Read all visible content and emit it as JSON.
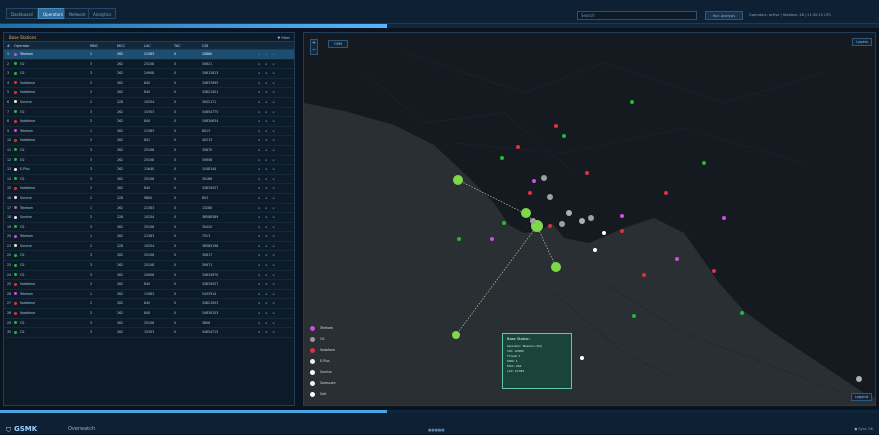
{
  "tabs": [
    "Dashboard",
    "Operators",
    "Network",
    "Analytics"
  ],
  "active_tab_index": 1,
  "search": {
    "placeholder": "Search"
  },
  "top_button": "Run Analysis",
  "status_text": "Operators: active | Stations: 48 | 21:30:15 UTC",
  "progress": 0.44,
  "left_panel": {
    "title": "Base Stations",
    "filter_label": "Filter",
    "columns": [
      "#",
      "Operator",
      "MNC",
      "MCC",
      "LAC",
      "TAC",
      "CID",
      ""
    ],
    "rows": [
      {
        "n": "1",
        "op": "Telekom",
        "mnc": "1",
        "mcc": "262",
        "lac": "21383",
        "tac": "0",
        "cid": "10880",
        "color": "#c850e0",
        "sel": true
      },
      {
        "n": "2",
        "op": "O2",
        "mnc": "3",
        "mcc": "262",
        "lac": "25108",
        "tac": "0",
        "cid": "30821",
        "color": "#22b838"
      },
      {
        "n": "3",
        "op": "O2",
        "mnc": "3",
        "mcc": "262",
        "lac": "24908",
        "tac": "0",
        "cid": "34612813",
        "color": "#22b838"
      },
      {
        "n": "4",
        "op": "Vodafone",
        "mnc": "2",
        "mcc": "262",
        "lac": "840",
        "tac": "0",
        "cid": "34837695",
        "color": "#e03040"
      },
      {
        "n": "5",
        "op": "Vodafone",
        "mnc": "2",
        "mcc": "262",
        "lac": "840",
        "tac": "0",
        "cid": "34821401",
        "color": "#e03040"
      },
      {
        "n": "6",
        "op": "Sunrise",
        "mnc": "2",
        "mcc": "228",
        "lac": "10254",
        "tac": "0",
        "cid": "3002171",
        "color": "#e8e8e8"
      },
      {
        "n": "7",
        "op": "O2",
        "mnc": "3",
        "mcc": "262",
        "lac": "15303",
        "tac": "0",
        "cid": "54654775",
        "color": "#22b838"
      },
      {
        "n": "8",
        "op": "Vodafone",
        "mnc": "2",
        "mcc": "262",
        "lac": "840",
        "tac": "0",
        "cid": "34820634",
        "color": "#e03040"
      },
      {
        "n": "9",
        "op": "Telekom",
        "mnc": "1",
        "mcc": "262",
        "lac": "21383",
        "tac": "0",
        "cid": "6013",
        "color": "#c850e0"
      },
      {
        "n": "10",
        "op": "Vodafone",
        "mnc": "2",
        "mcc": "262",
        "lac": "841",
        "tac": "0",
        "cid": "40213",
        "color": "#e03040"
      },
      {
        "n": "11",
        "op": "O2",
        "mnc": "3",
        "mcc": "262",
        "lac": "25108",
        "tac": "0",
        "cid": "30870",
        "color": "#22b838"
      },
      {
        "n": "12",
        "op": "O2",
        "mnc": "3",
        "mcc": "262",
        "lac": "25108",
        "tac": "0",
        "cid": "30658",
        "color": "#22b838"
      },
      {
        "n": "13",
        "op": "E-Plus",
        "mnc": "3",
        "mcc": "262",
        "lac": "11640",
        "tac": "0",
        "cid": "1048144",
        "color": "#f0f0f0"
      },
      {
        "n": "14",
        "op": "O2",
        "mnc": "3",
        "mcc": "262",
        "lac": "25108",
        "tac": "0",
        "cid": "30166",
        "color": "#22b838"
      },
      {
        "n": "15",
        "op": "Vodafone",
        "mnc": "2",
        "mcc": "262",
        "lac": "840",
        "tac": "0",
        "cid": "34834057",
        "color": "#e03040"
      },
      {
        "n": "16",
        "op": "Sunrise",
        "mnc": "2",
        "mcc": "228",
        "lac": "9800",
        "tac": "0",
        "cid": "803",
        "color": "#e8e8e8"
      },
      {
        "n": "17",
        "op": "Telekom",
        "mnc": "1",
        "mcc": "262",
        "lac": "21383",
        "tac": "0",
        "cid": "13280",
        "color": "#c850e0"
      },
      {
        "n": "18",
        "op": "Sunrise",
        "mnc": "2",
        "mcc": "228",
        "lac": "10254",
        "tac": "0",
        "cid": "38588389",
        "color": "#e8e8e8"
      },
      {
        "n": "19",
        "op": "O2",
        "mnc": "3",
        "mcc": "262",
        "lac": "25108",
        "tac": "0",
        "cid": "30420",
        "color": "#22b838"
      },
      {
        "n": "20",
        "op": "Telekom",
        "mnc": "1",
        "mcc": "262",
        "lac": "21383",
        "tac": "0",
        "cid": "7513",
        "color": "#c850e0"
      },
      {
        "n": "21",
        "op": "Sunrise",
        "mnc": "2",
        "mcc": "228",
        "lac": "10254",
        "tac": "0",
        "cid": "38585198",
        "color": "#e8e8e8"
      },
      {
        "n": "22",
        "op": "O2",
        "mnc": "3",
        "mcc": "262",
        "lac": "25108",
        "tac": "0",
        "cid": "30817",
        "color": "#22b838"
      },
      {
        "n": "23",
        "op": "O2",
        "mnc": "3",
        "mcc": "262",
        "lac": "25108",
        "tac": "0",
        "cid": "30671",
        "color": "#22b838"
      },
      {
        "n": "24",
        "op": "O2",
        "mnc": "3",
        "mcc": "262",
        "lac": "24908",
        "tac": "0",
        "cid": "34634970",
        "color": "#22b838"
      },
      {
        "n": "25",
        "op": "Vodafone",
        "mnc": "2",
        "mcc": "262",
        "lac": "840",
        "tac": "0",
        "cid": "34834057",
        "color": "#e03040"
      },
      {
        "n": "26",
        "op": "Telekom",
        "mnc": "1",
        "mcc": "262",
        "lac": "11983",
        "tac": "0",
        "cid": "3433514",
        "color": "#c850e0"
      },
      {
        "n": "27",
        "op": "Vodafone",
        "mnc": "2",
        "mcc": "262",
        "lac": "840",
        "tac": "0",
        "cid": "34821003",
        "color": "#e03040"
      },
      {
        "n": "28",
        "op": "Vodafone",
        "mnc": "2",
        "mcc": "262",
        "lac": "840",
        "tac": "0",
        "cid": "34830253",
        "color": "#e03040"
      },
      {
        "n": "29",
        "op": "O2",
        "mnc": "3",
        "mcc": "262",
        "lac": "25108",
        "tac": "0",
        "cid": "3808",
        "color": "#22b838"
      },
      {
        "n": "30",
        "op": "O2",
        "mnc": "3",
        "mcc": "262",
        "lac": "15303",
        "tac": "0",
        "cid": "54654715",
        "color": "#22b838"
      }
    ]
  },
  "map": {
    "zoom_plus": "+",
    "zoom_minus": "−",
    "layer_label": "OSM",
    "layers_button": "Layers",
    "legend_button": "Legend"
  },
  "legend": [
    {
      "label": "Telekom",
      "color": "#c850e0"
    },
    {
      "label": "O2",
      "color": "#9a9a9a"
    },
    {
      "label": "Vodafone",
      "color": "#e03040"
    },
    {
      "label": "E-Plus",
      "color": "#f0f0f0"
    },
    {
      "label": "Sunrise",
      "color": "#ffffff"
    },
    {
      "label": "Swisscom",
      "color": "#f4f4f4"
    },
    {
      "label": "Salt",
      "color": "#ffffff"
    }
  ],
  "tooltip": {
    "title": "Base Station",
    "lines": [
      "Operator: Telekom (O2)",
      "CID: 10880",
      "Threat: 1",
      "MNC: 1",
      "MCC: 262",
      "LAC: 21383"
    ]
  },
  "bottom": {
    "logo": "GSMK",
    "app": "Overwatch",
    "center": "■■■■■",
    "right": "● Sync OK"
  }
}
